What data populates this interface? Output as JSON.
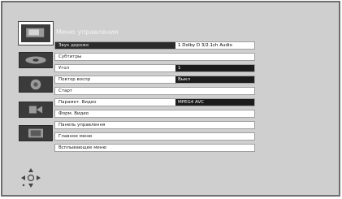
{
  "menu": {
    "title": "Меню управления"
  },
  "rows": [
    {
      "label": "Звук дорожк",
      "value": "1 Dolby D 3/2.1ch  Audio",
      "style": "wht"
    },
    {
      "label": "Субтитры",
      "value": ""
    },
    {
      "label": "Угол",
      "value": "1",
      "style": "dark"
    },
    {
      "label": "Повтор воспр",
      "value": "Выкл",
      "style": "dark"
    },
    {
      "label": "Старт",
      "value": ""
    },
    {
      "label": "Парамет. Видео",
      "value": "MPEG4 AVC",
      "style": "dark"
    },
    {
      "label": "Форм. Видео",
      "value": ""
    },
    {
      "label": "Панель управлення",
      "value": ""
    },
    {
      "label": "Главное меню",
      "value": ""
    },
    {
      "label": "Всплывающее меню",
      "value": ""
    }
  ],
  "icons": [
    {
      "name": "disc-active-icon"
    },
    {
      "name": "disc-flat-icon"
    },
    {
      "name": "speaker-icon"
    },
    {
      "name": "settings-icon"
    },
    {
      "name": "tv-icon"
    }
  ],
  "nav_hint_icon": "dpad-navigation-icon"
}
